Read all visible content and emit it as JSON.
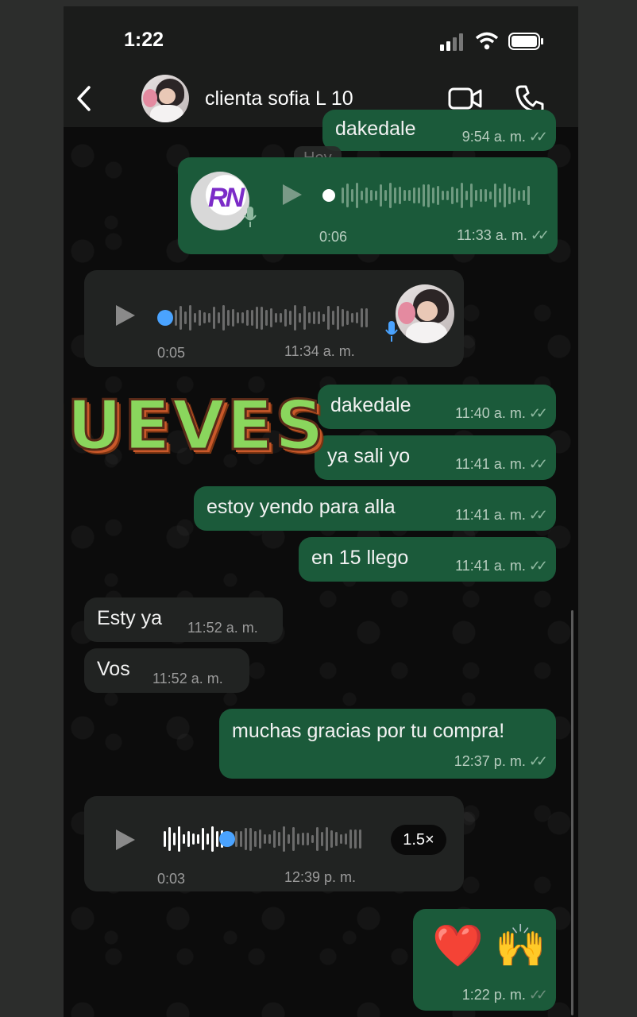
{
  "status_bar": {
    "time": "1:22"
  },
  "header": {
    "contact_name": "clienta sofia L 10"
  },
  "date_chip": "Hoy",
  "overlay_sticker": "JUEVES",
  "colors": {
    "outgoing_bubble": "#1b5a3a",
    "incoming_bubble": "#212322",
    "voice_dot": "#4aa3ff",
    "sticker_green": "#8ad65d",
    "sticker_orange": "#c9592a"
  },
  "messages": [
    {
      "type": "text",
      "direction": "out",
      "text": "dakedale",
      "time": "9:54 a. m.",
      "partial": true
    },
    {
      "type": "voice",
      "direction": "out",
      "duration": "0:06",
      "time": "11:33 a. m.",
      "sender_avatar_label": "RN",
      "progress": 0
    },
    {
      "type": "voice",
      "direction": "in",
      "duration": "0:05",
      "time": "11:34 a. m.",
      "progress": 0
    },
    {
      "type": "text",
      "direction": "out",
      "text": "dakedale",
      "time": "11:40 a. m."
    },
    {
      "type": "text",
      "direction": "out",
      "text": "ya sali yo",
      "time": "11:41 a. m."
    },
    {
      "type": "text",
      "direction": "out",
      "text": "estoy yendo para alla",
      "time": "11:41 a. m."
    },
    {
      "type": "text",
      "direction": "out",
      "text": "en 15 llego",
      "time": "11:41 a. m."
    },
    {
      "type": "text",
      "direction": "in",
      "text": "Esty ya",
      "time": "11:52 a. m."
    },
    {
      "type": "text",
      "direction": "in",
      "text": "Vos",
      "time": "11:52 a. m."
    },
    {
      "type": "text",
      "direction": "out",
      "text": "muchas gracias por tu compra!",
      "time": "12:37 p. m."
    },
    {
      "type": "voice",
      "direction": "in",
      "duration": "0:03",
      "time": "12:39 p. m.",
      "speed": "1.5×",
      "progress": 0.3
    },
    {
      "type": "emoji",
      "direction": "out",
      "text": "❤️ 🙌",
      "time": "1:22 p. m."
    }
  ]
}
